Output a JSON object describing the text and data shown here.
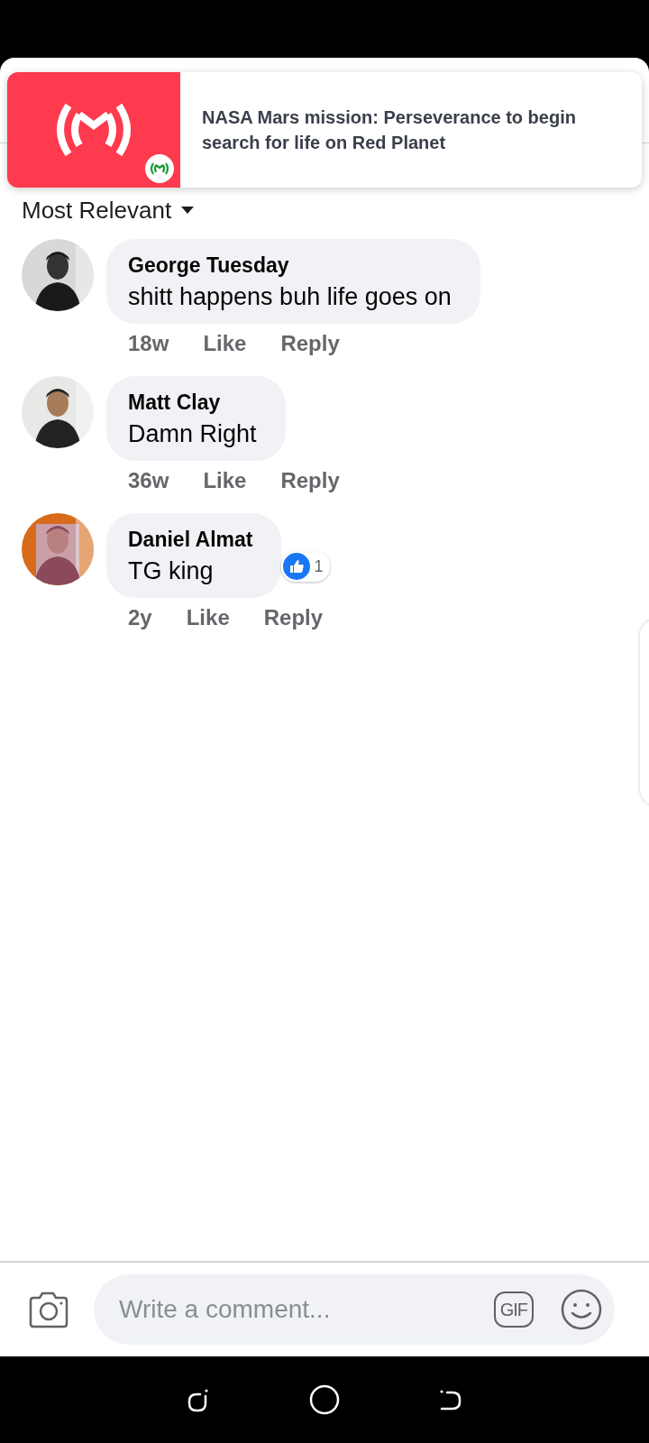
{
  "notification": {
    "headline": "NASA Mars mission: Perseverance to begin search for life on Red Planet"
  },
  "sort": {
    "label": "Most Relevant"
  },
  "comments": [
    {
      "author": "George Tuesday",
      "text": "shitt happens buh life goes on",
      "time": "18w",
      "like": "Like",
      "reply": "Reply",
      "liked": false
    },
    {
      "author": "Matt Clay",
      "text": "Damn Right",
      "time": "36w",
      "like": "Like",
      "reply": "Reply",
      "liked": false
    },
    {
      "author": "Daniel Almat",
      "text": "TG king",
      "time": "2y",
      "like": "Like",
      "reply": "Reply",
      "liked": false,
      "reaction_count": "1"
    }
  ],
  "composer": {
    "placeholder": "Write a comment...",
    "gif": "GIF"
  }
}
